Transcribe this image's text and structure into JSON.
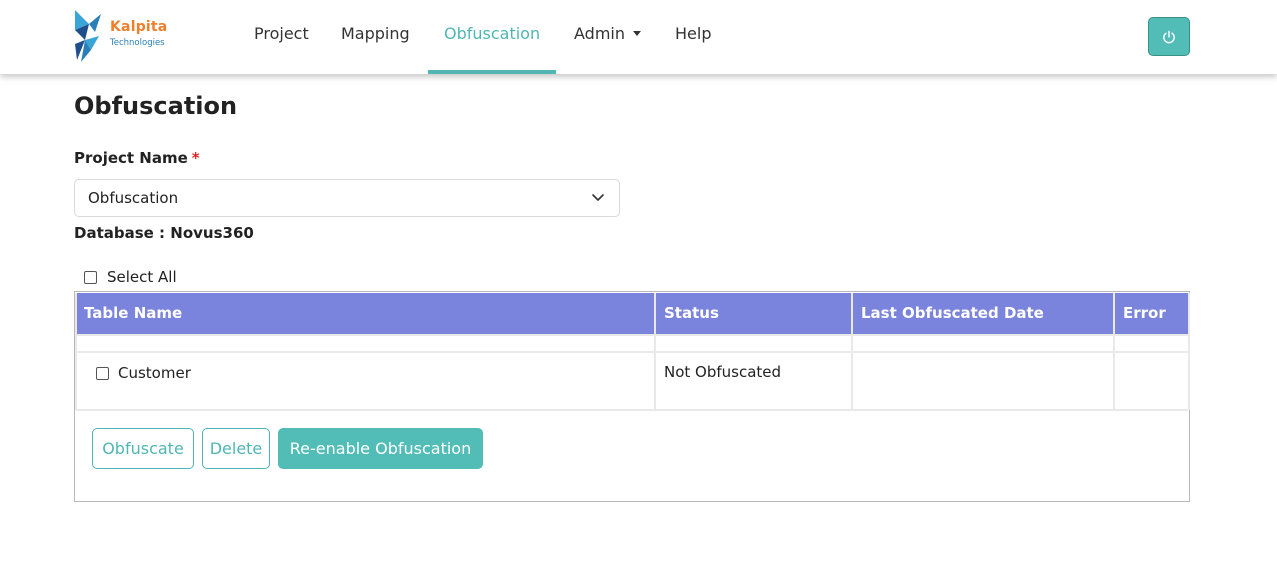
{
  "brand": {
    "name": "Kalpita",
    "tagline": "Technologies"
  },
  "nav": {
    "items": [
      {
        "label": "Project"
      },
      {
        "label": "Mapping"
      },
      {
        "label": "Obfuscation",
        "active": true
      },
      {
        "label": "Admin",
        "dropdown": true
      },
      {
        "label": "Help"
      }
    ],
    "power_icon": "power-icon"
  },
  "page": {
    "title": "Obfuscation",
    "project_label": "Project Name",
    "required_mark": "*",
    "project_selected": "Obfuscation",
    "database_label": "Database :",
    "database_value": "Novus360",
    "select_all_label": "Select All"
  },
  "table": {
    "columns": [
      "Table Name",
      "Status",
      "Last Obfuscated Date",
      "Error"
    ],
    "rows": [
      {
        "table_name": "Customer",
        "status": "Not Obfuscated",
        "last_obfuscated_date": "",
        "error": "",
        "checked": false
      }
    ]
  },
  "actions": {
    "obfuscate": "Obfuscate",
    "delete": "Delete",
    "reenable": "Re-enable Obfuscation"
  },
  "colors": {
    "accent": "#4fb6b3",
    "header_bg": "#7b84dd",
    "required": "#e02020",
    "brand_orange": "#f07f2c"
  }
}
